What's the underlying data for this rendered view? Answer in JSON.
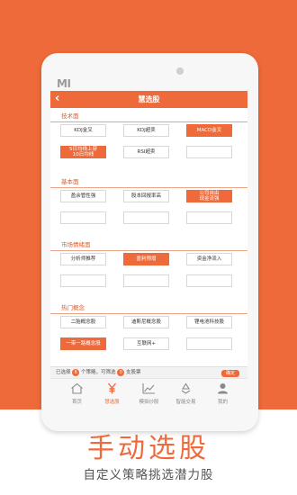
{
  "app": {
    "logo": "MI",
    "title": "慧选股",
    "back_icon": "chevron-left-icon"
  },
  "sections": [
    {
      "title": "技术面",
      "buttons": [
        {
          "label": "KDJ金叉",
          "selected": false
        },
        {
          "label": "KDJ超卖",
          "selected": false
        },
        {
          "label": "MACD金叉",
          "selected": true
        },
        {
          "label": "5日均线上穿\n10日均线",
          "selected": true
        },
        {
          "label": "RSI超卖",
          "selected": false
        },
        {
          "label": "",
          "selected": false
        }
      ]
    },
    {
      "title": "基本面",
      "buttons": [
        {
          "label": "盈余管性强",
          "selected": false
        },
        {
          "label": "股本回报率高",
          "selected": false
        },
        {
          "label": "公司自由\n现金流强",
          "selected": true
        },
        {
          "label": "",
          "selected": false
        },
        {
          "label": "",
          "selected": false
        },
        {
          "label": "",
          "selected": false
        }
      ]
    },
    {
      "title": "市场情绪面",
      "buttons": [
        {
          "label": "分析师推荐",
          "selected": false
        },
        {
          "label": "盈利预增",
          "selected": true
        },
        {
          "label": "资金净流入",
          "selected": false
        },
        {
          "label": "",
          "selected": false
        },
        {
          "label": "",
          "selected": false
        },
        {
          "label": "",
          "selected": false
        }
      ]
    },
    {
      "title": "热门概念",
      "buttons": [
        {
          "label": "二胎概念股",
          "selected": false
        },
        {
          "label": "迪斯尼概念股",
          "selected": false
        },
        {
          "label": "锂电池科技股",
          "selected": false
        },
        {
          "label": "一带一路概念股",
          "selected": true
        },
        {
          "label": "互联网+",
          "selected": false
        },
        {
          "label": "",
          "selected": false
        }
      ]
    }
  ],
  "status": {
    "prefix": "已选择",
    "selected_count": "6",
    "middle": "个策略，可筛选",
    "result_count": "0",
    "suffix": "支股票",
    "confirm_label": "确定"
  },
  "tabs": [
    {
      "label": "首页",
      "icon": "home-icon",
      "active": false
    },
    {
      "label": "慧选股",
      "icon": "yen-icon",
      "active": true
    },
    {
      "label": "模拟炒股",
      "icon": "chart-line-icon",
      "active": false
    },
    {
      "label": "智能交易",
      "icon": "recycle-icon",
      "active": false
    },
    {
      "label": "我的",
      "icon": "user-icon",
      "active": false
    }
  ],
  "caption": {
    "headline": "手动选股",
    "subline": "自定义策略挑选潜力股"
  },
  "colors": {
    "accent": "#ee6a3a",
    "background_white": "#ffffff"
  }
}
